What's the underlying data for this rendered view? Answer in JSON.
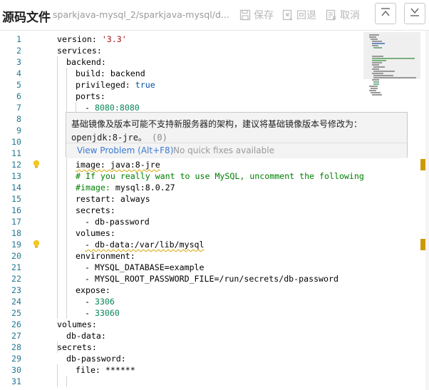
{
  "header": {
    "title": "源码文件",
    "path": "sparkjava-mysql_2/sparkjava-mysql/d...",
    "save_label": "保存",
    "revert_label": "回退",
    "cancel_label": "取消",
    "icons": [
      "save-icon",
      "revert-icon",
      "cancel-icon",
      "scroll-top-icon",
      "scroll-bottom-icon"
    ]
  },
  "editor": {
    "line_numbers": [
      "1",
      "2",
      "3",
      "4",
      "5",
      "6",
      "7",
      "8",
      "9",
      "10",
      "11",
      "12",
      "13",
      "14",
      "15",
      "16",
      "17",
      "18",
      "19",
      "20",
      "21",
      "22",
      "23",
      "24",
      "25",
      "26",
      "27",
      "28",
      "29",
      "30",
      "31"
    ],
    "lines": {
      "l1_key": "version:",
      "l1_val": "'3.3'",
      "l2": "services:",
      "l3": "backend:",
      "l4_key": "build:",
      "l4_val": "backend",
      "l5_key": "privileged:",
      "l5_val": "true",
      "l6": "ports:",
      "l7_dash": "-",
      "l7_val": "8080:8080",
      "l12_key": "image:",
      "l12_val": "java:8-jre",
      "l13": "# If you really want to use MySQL, uncomment the following lin",
      "l14_c": "#image:",
      "l14_v": "mysql:8.0.27",
      "l15_key": "restart:",
      "l15_val": "always",
      "l16": "secrets:",
      "l17": "- db-password",
      "l18": "volumes:",
      "l19": "- db-data:/var/lib/mysql",
      "l20": "environment:",
      "l21": "- MYSQL_DATABASE=example",
      "l22": "- MYSQL_ROOT_PASSWORD_FILE=/run/secrets/db-password",
      "l23": "expose:",
      "l24_dash": "-",
      "l24_val": "3306",
      "l25_dash": "-",
      "l25_val": "33060",
      "l26": "volumes:",
      "l27": "db-data:",
      "l28": "secrets:",
      "l29": "db-password:",
      "l30_key": "file:",
      "l30_val": "******"
    }
  },
  "hover": {
    "message": "基础镜像及版本可能不支持新服务器的架构，建议将基础镜像版本号修改为：",
    "suggestion": "openjdk:8-jre。",
    "count": "(0)",
    "view_problem": "View Problem (Alt+F8)",
    "no_fixes": "No quick fixes available"
  },
  "colors": {
    "line_number": "#237893",
    "string": "#a31515",
    "number": "#098658",
    "keyword_value": "#0451a5",
    "comment": "#008000",
    "warning": "#cc9a06",
    "link": "#3a7bd5"
  }
}
